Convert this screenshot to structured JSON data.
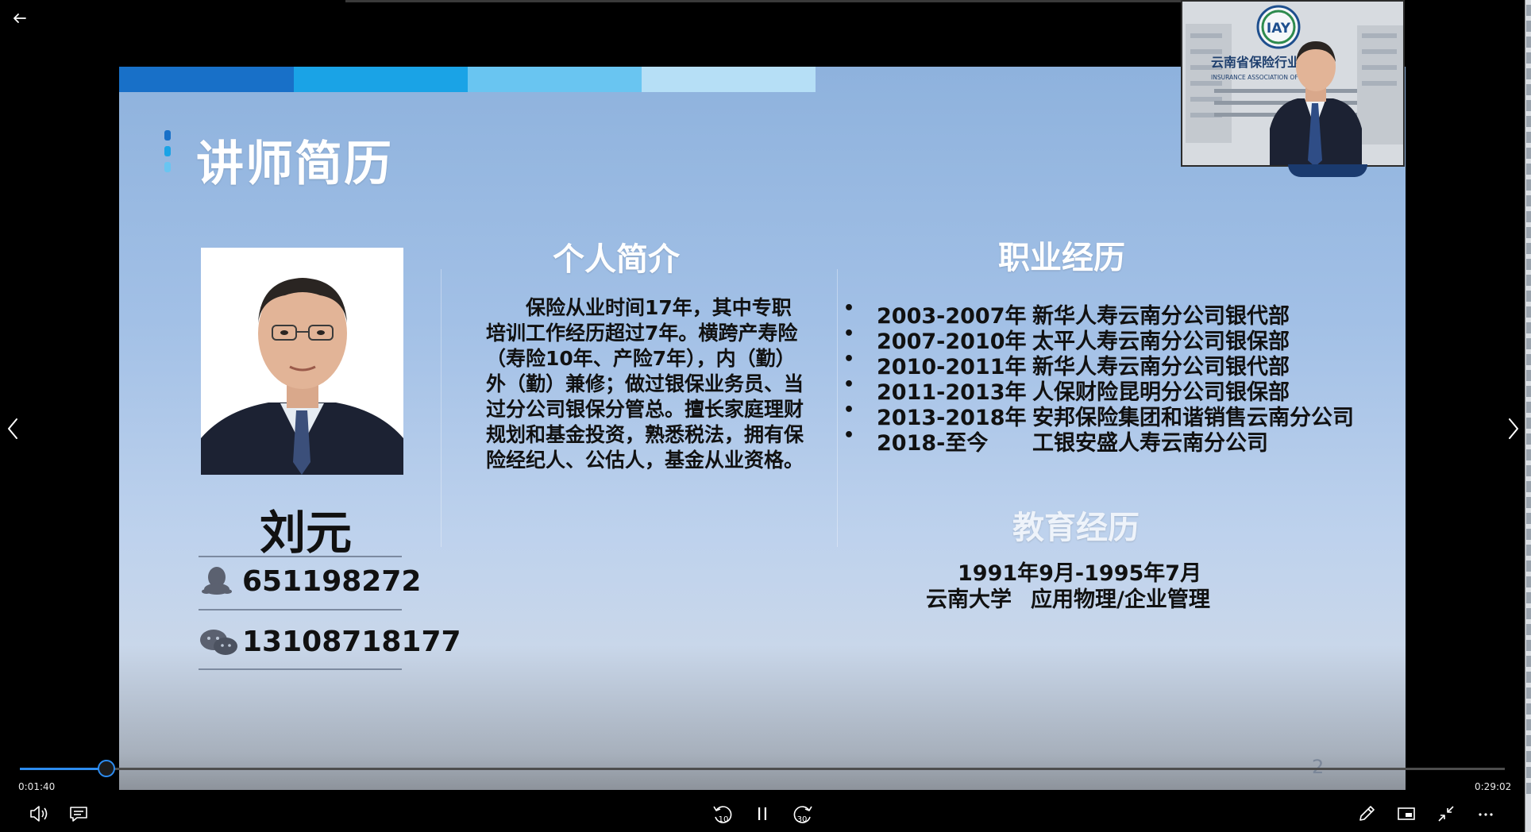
{
  "slide": {
    "title": "讲师简历",
    "page_number": "2",
    "instructor": {
      "name": "刘元",
      "qq": "651198272",
      "wechat": "13108718177"
    },
    "intro": {
      "heading": "个人简介",
      "text": "保险从业时间17年，其中专职培训工作经历超过7年。横跨产寿险（寿险10年、产险7年），内（勤）外（勤）兼修；做过银保业务员、当过分公司银保分管总。擅长家庭理财规划和基金投资，熟悉税法，拥有保险经纪人、公估人，基金从业资格。"
    },
    "career": {
      "heading": "职业经历",
      "items": [
        {
          "years": "2003-2007年",
          "company": "新华人寿云南分公司银代部"
        },
        {
          "years": "2007-2010年",
          "company": "太平人寿云南分公司银保部"
        },
        {
          "years": "2010-2011年",
          "company": "新华人寿云南分公司银代部"
        },
        {
          "years": "2011-2013年",
          "company": "人保财险昆明分公司银保部"
        },
        {
          "years": "2013-2018年",
          "company": "安邦保险集团和谐销售云南分公司"
        },
        {
          "years": "2018-至今",
          "company": "工银安盛人寿云南分公司"
        }
      ]
    },
    "education": {
      "heading": "教育经历",
      "period": "1991年9月-1995年7月",
      "school": "云南大学",
      "major": "应用物理/企业管理"
    }
  },
  "webcam": {
    "logo_text": "IAY",
    "sign_text": "云南省保险行业协会",
    "sign_sub": "INSURANCE ASSOCIATION OF YUNNAN"
  },
  "player": {
    "current_time": "0:01:40",
    "total_time": "0:29:02",
    "progress": 0.0574,
    "skip_back_label": "10",
    "skip_forward_label": "30"
  },
  "icons": {
    "back": "back-arrow-icon",
    "prev": "chevron-left-icon",
    "next": "chevron-right-icon",
    "volume": "volume-icon",
    "captions": "captions-icon",
    "skip_back": "skip-back-10-icon",
    "pause": "pause-icon",
    "skip_forward": "skip-forward-30-icon",
    "pen": "pen-icon",
    "mini_player": "mini-player-icon",
    "fullscreen_exit": "exit-fullscreen-icon",
    "more": "more-icon",
    "qq": "qq-icon",
    "wechat": "wechat-icon"
  },
  "colors": {
    "accent": "#2d8cf0",
    "band1": "#1870c8",
    "band2": "#1aa3e6",
    "band3": "#69c5f1",
    "band4": "#b6dff6"
  }
}
